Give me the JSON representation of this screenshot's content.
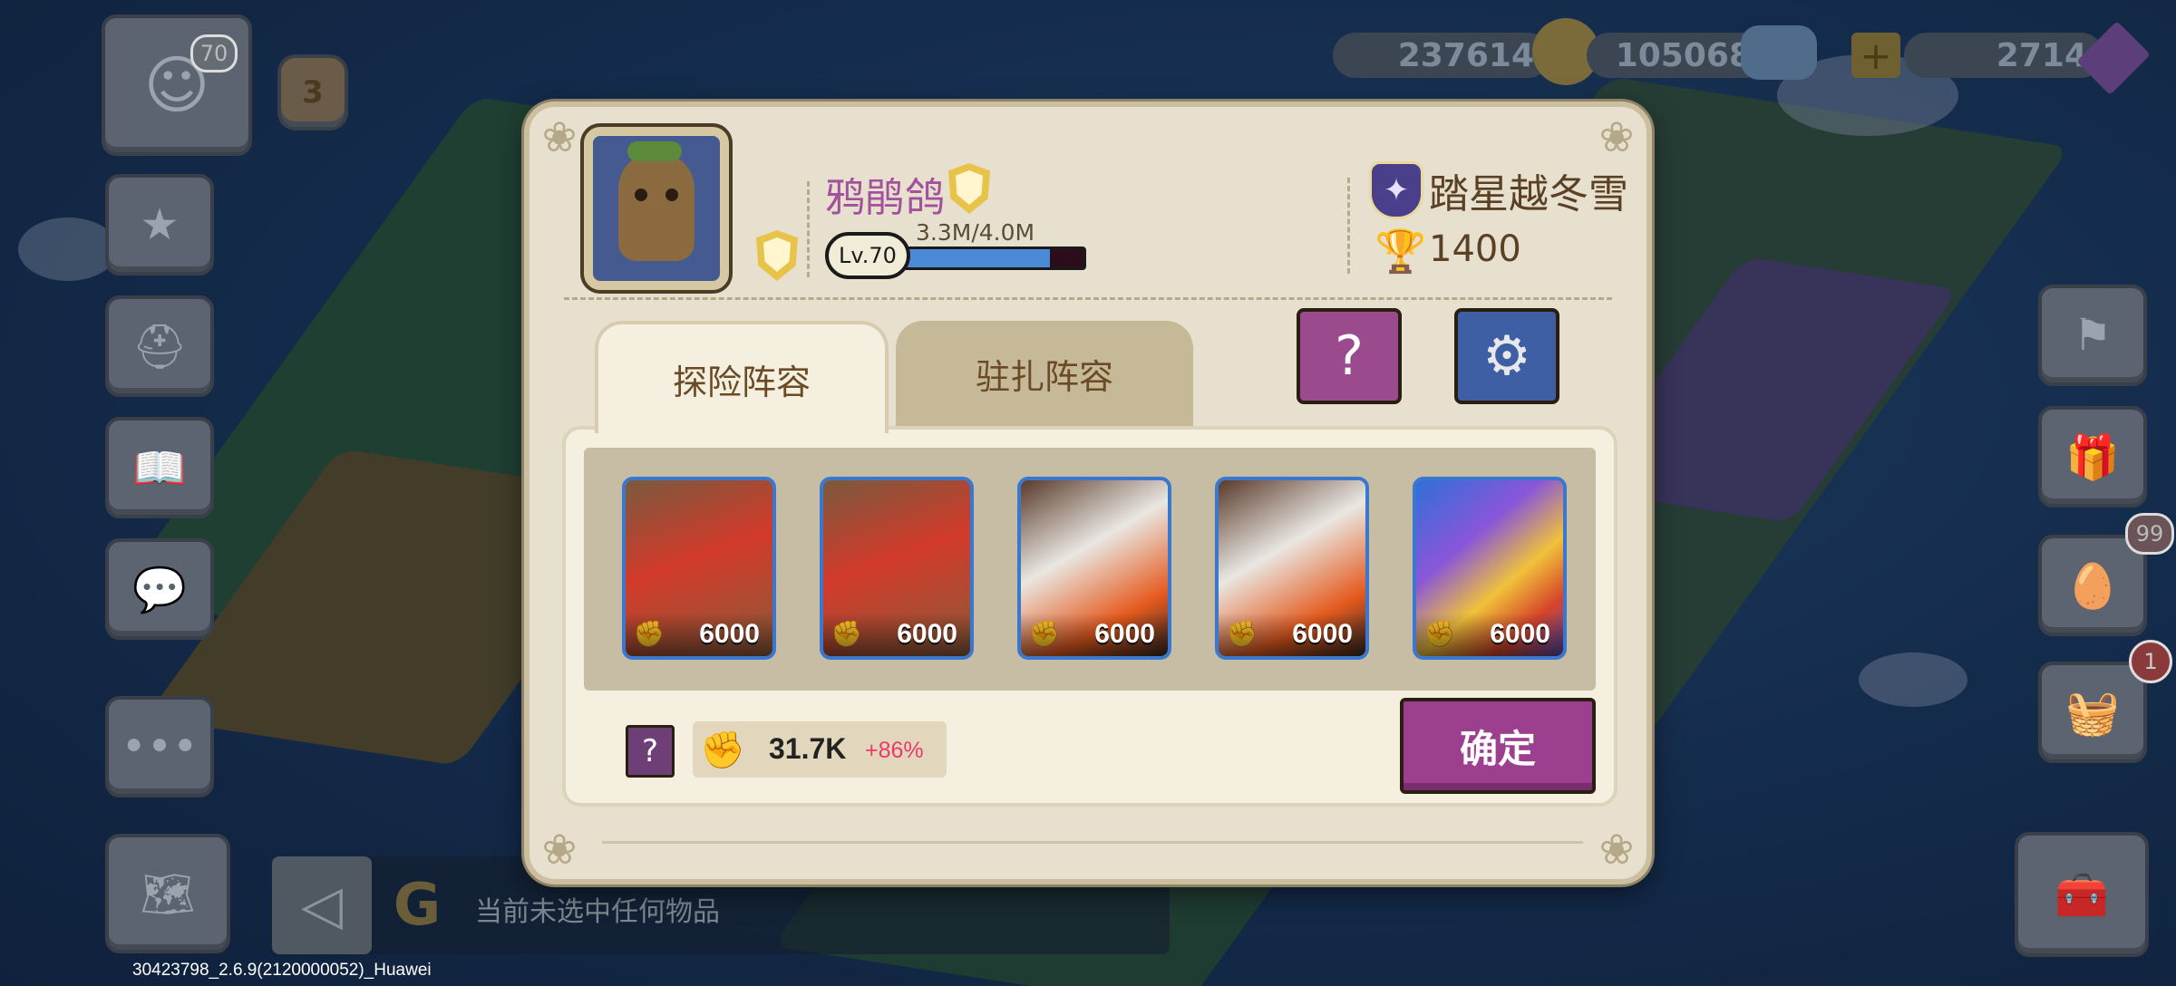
{
  "hud": {
    "avatar_level": "70",
    "rank_badge": "3",
    "gold": "237614",
    "crystal": "105068",
    "gems": "2714",
    "egg_badge": "99",
    "reward_badge": "1",
    "build_version": "30423798_2.6.9(2120000052)_Huawei",
    "inventory_hint": "当前未选中任何物品"
  },
  "profile": {
    "player_name": "鸦鹃鸽",
    "level_label": "Lv.70",
    "xp_text": "3.3M/4.0M",
    "xp_fraction": 0.825,
    "guild_name": "踏星越冬雪",
    "trophies": "1400"
  },
  "tabs": [
    {
      "label": "探险阵容",
      "active": true
    },
    {
      "label": "驻扎阵容",
      "active": false
    }
  ],
  "team": {
    "slots": [
      {
        "name": "red-crystal-golem",
        "power": "6000"
      },
      {
        "name": "red-crystal-golem",
        "power": "6000"
      },
      {
        "name": "white-maned-beast",
        "power": "6000"
      },
      {
        "name": "white-maned-beast",
        "power": "6000"
      },
      {
        "name": "rainbow-phoenix",
        "power": "6000"
      }
    ],
    "total_power": "31.7K",
    "bonus": "+86%"
  },
  "buttons": {
    "confirm": "确定",
    "help_glyph": "?",
    "help_small_glyph": "?"
  },
  "colors": {
    "accent_purple": "#9c3f8e",
    "xp_blue": "#4a8ad6",
    "name_purple": "#a3519c",
    "bonus_pink": "#ea3a6a",
    "slot_border": "#3a78d0"
  }
}
